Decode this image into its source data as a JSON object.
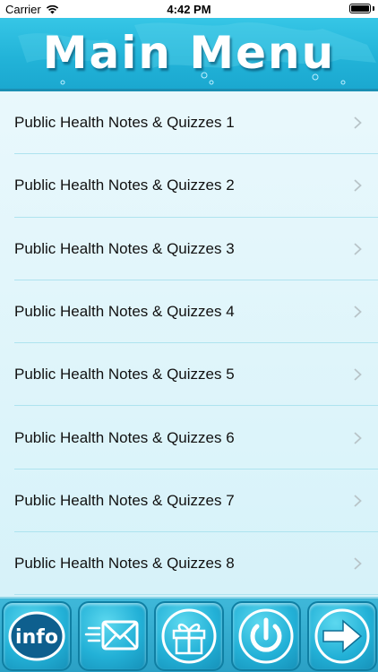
{
  "status_bar": {
    "carrier": "Carrier",
    "time": "4:42 PM"
  },
  "header": {
    "title": "Main Menu"
  },
  "menu": {
    "items": [
      {
        "label": "Public Health Notes & Quizzes 1"
      },
      {
        "label": "Public Health Notes & Quizzes 2"
      },
      {
        "label": "Public Health Notes & Quizzes 3"
      },
      {
        "label": "Public Health Notes & Quizzes 4"
      },
      {
        "label": "Public Health Notes & Quizzes 5"
      },
      {
        "label": "Public Health Notes & Quizzes 6"
      },
      {
        "label": "Public Health Notes & Quizzes 7"
      },
      {
        "label": "Public Health Notes & Quizzes 8"
      }
    ]
  },
  "toolbar": {
    "info_label": "info",
    "icons": [
      "info-icon",
      "mail-icon",
      "gift-icon",
      "power-icon",
      "arrow-right-icon"
    ]
  },
  "colors": {
    "header_blue": "#22b3d8",
    "list_background": "#e6f7fb",
    "separator": "#aee3ef",
    "toolbar_blue": "#2aa0c5"
  }
}
